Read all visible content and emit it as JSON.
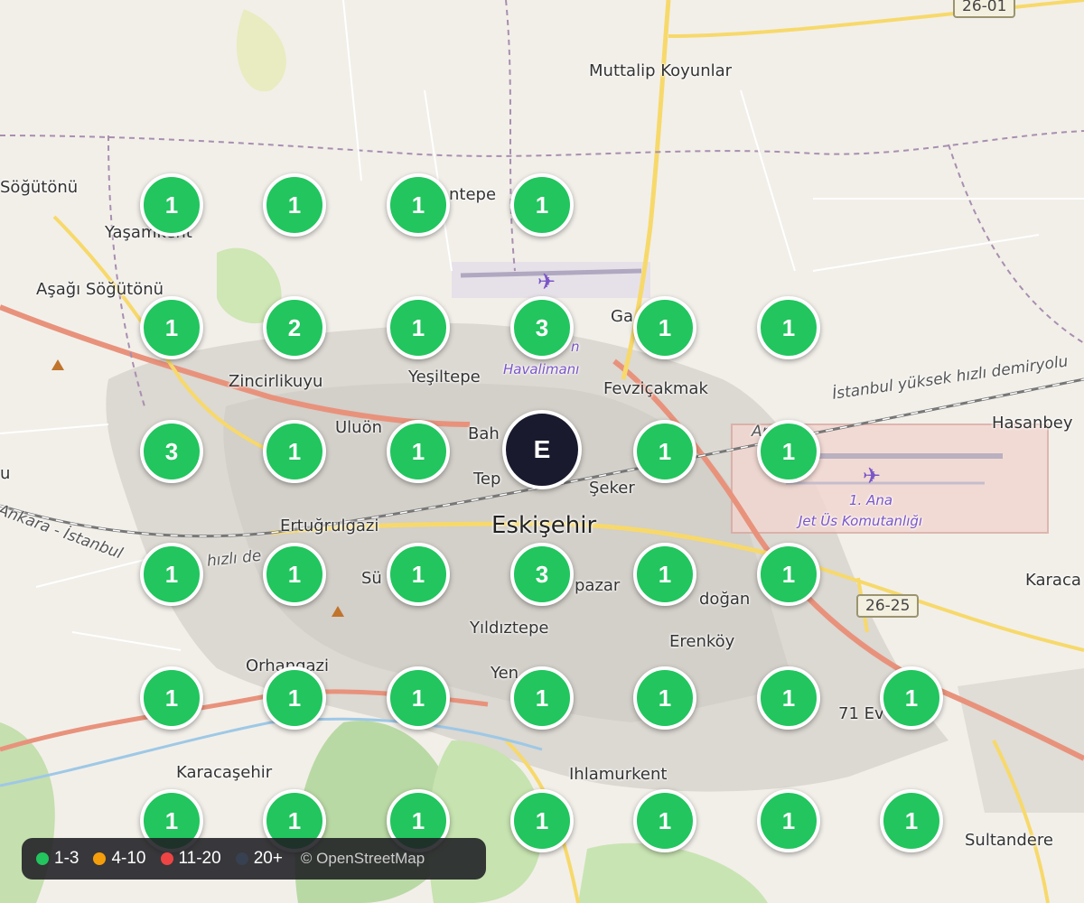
{
  "map": {
    "places": [
      {
        "id": "muttalip",
        "label": "Muttalip Koyunlar"
      },
      {
        "id": "sogutonu",
        "label": "Söğütönü"
      },
      {
        "id": "yasamkent",
        "label": "Yaşamkent"
      },
      {
        "id": "asagisogutonu",
        "label": "Aşağı Söğütönü"
      },
      {
        "id": "entepe",
        "label": "ntepe"
      },
      {
        "id": "zincirlikuyu",
        "label": "Zincirlikuyu"
      },
      {
        "id": "yesiltepe",
        "label": "Yeşiltepe"
      },
      {
        "id": "fevzicakmak",
        "label": "Fevziçakmak"
      },
      {
        "id": "uluonder",
        "label": "Uluön"
      },
      {
        "id": "bahcelievler",
        "label": "Bah"
      },
      {
        "id": "tepebasi",
        "label": "Tep"
      },
      {
        "id": "seker",
        "label": "Şeker"
      },
      {
        "id": "eskisehir",
        "label": "Eskişehir"
      },
      {
        "id": "ertugrulgazi",
        "label": "Ertuğrulgazi"
      },
      {
        "id": "hasanbey",
        "label": "Hasanbey"
      },
      {
        "id": "sultandere",
        "label": "Sultandere"
      },
      {
        "id": "karacasehir",
        "label": "Karacaşehir"
      },
      {
        "id": "ihlamurkent",
        "label": "Ihlamurkent"
      },
      {
        "id": "orhangazi",
        "label": "Orhangazi"
      },
      {
        "id": "yildiztepe",
        "label": "Yıldıztepe"
      },
      {
        "id": "erenkoy",
        "label": "Erenköy"
      },
      {
        "id": "odunpazari",
        "label": "pazar"
      },
      {
        "id": "emek",
        "label": "doğan"
      },
      {
        "id": "yenikent",
        "label": "Yen"
      },
      {
        "id": "71evler",
        "label": "71 Ev"
      },
      {
        "id": "karacaoren",
        "label": "Karaca"
      },
      {
        "id": "sumer",
        "label": "Sü"
      },
      {
        "id": "gunduzler",
        "label": "Ga"
      },
      {
        "id": "u_left",
        "label": "u"
      },
      {
        "id": "airport",
        "label": "Havalimanı"
      },
      {
        "id": "airport_n",
        "label": "n"
      },
      {
        "id": "jetus",
        "label": "1. Ana"
      },
      {
        "id": "jetus2",
        "label": "Jet Üs Komutanlığı"
      },
      {
        "id": "rail1",
        "label": "İstanbul yüksek hızlı demiryolu"
      },
      {
        "id": "rail2",
        "label": "Ankara - İstanbul"
      },
      {
        "id": "rail3",
        "label": "hızlı de"
      },
      {
        "id": "rail4",
        "label": "An"
      }
    ],
    "shields": [
      {
        "id": "s1",
        "label": "26-01"
      },
      {
        "id": "s2",
        "label": "26-25"
      }
    ]
  },
  "markers": [
    {
      "label": "1",
      "type": "green"
    },
    {
      "label": "1",
      "type": "green"
    },
    {
      "label": "1",
      "type": "green"
    },
    {
      "label": "1",
      "type": "green"
    },
    {
      "label": "1",
      "type": "green"
    },
    {
      "label": "2",
      "type": "green"
    },
    {
      "label": "1",
      "type": "green"
    },
    {
      "label": "3",
      "type": "green"
    },
    {
      "label": "1",
      "type": "green"
    },
    {
      "label": "1",
      "type": "green"
    },
    {
      "label": "3",
      "type": "green"
    },
    {
      "label": "1",
      "type": "green"
    },
    {
      "label": "1",
      "type": "green"
    },
    {
      "label": "E",
      "type": "dark"
    },
    {
      "label": "1",
      "type": "green"
    },
    {
      "label": "1",
      "type": "green"
    },
    {
      "label": "1",
      "type": "green"
    },
    {
      "label": "1",
      "type": "green"
    },
    {
      "label": "1",
      "type": "green"
    },
    {
      "label": "3",
      "type": "green"
    },
    {
      "label": "1",
      "type": "green"
    },
    {
      "label": "1",
      "type": "green"
    },
    {
      "label": "1",
      "type": "green"
    },
    {
      "label": "1",
      "type": "green"
    },
    {
      "label": "1",
      "type": "green"
    },
    {
      "label": "1",
      "type": "green"
    },
    {
      "label": "1",
      "type": "green"
    },
    {
      "label": "1",
      "type": "green"
    },
    {
      "label": "1",
      "type": "green"
    },
    {
      "label": "1",
      "type": "green"
    },
    {
      "label": "1",
      "type": "green"
    },
    {
      "label": "1",
      "type": "green"
    },
    {
      "label": "1",
      "type": "green"
    },
    {
      "label": "1",
      "type": "green"
    },
    {
      "label": "1",
      "type": "green"
    },
    {
      "label": "1",
      "type": "green"
    }
  ],
  "legend": {
    "items": [
      {
        "label": "1-3",
        "color": "#22c55e"
      },
      {
        "label": "4-10",
        "color": "#f59e0b"
      },
      {
        "label": "11-20",
        "color": "#ef4444"
      },
      {
        "label": "20+",
        "color": "#374151"
      }
    ],
    "attribution": "© OpenStreetMap"
  },
  "colors": {
    "marker_green": "#22c55e",
    "marker_dark": "#1a1a2e",
    "motorway": "#e8927c",
    "primary": "#f7d96b"
  }
}
